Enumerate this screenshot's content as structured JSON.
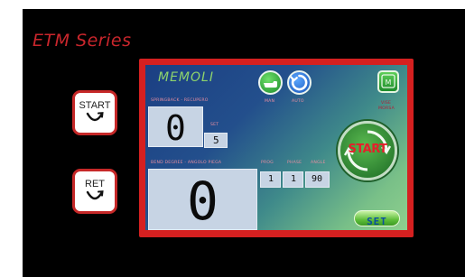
{
  "header": {
    "series_title": "ETM Series"
  },
  "side_buttons": {
    "start_label": "START",
    "ret_label": "RET"
  },
  "screen": {
    "brand": "MEMOLI",
    "springback_label": "SPRINGBACK - RECUPERO",
    "springback_value": "0",
    "set_label": "SET",
    "set_value": "5",
    "bend_label": "BEND DEGREE - ANGOLO PIEGA",
    "bend_value": "0",
    "prog_label": "PROG",
    "phase_label": "PHASE",
    "angle_label": "ANGLE",
    "prog_value": "1",
    "phase_value": "1",
    "angle_value": "90",
    "man_label": "MAN",
    "auto_label": "AUTO",
    "vise_label": "VISE",
    "morsa_label": "MORSA",
    "vise_icon_text": "M",
    "start_button_label": "START",
    "set_button_label": "SET"
  },
  "colors": {
    "frame": "#000000",
    "panel_border": "#d52020",
    "brand_green": "#8ed46c",
    "title_red": "#c9262c",
    "lcd": "#c7d4e4",
    "start_button": "#2f8d3a"
  },
  "icons": {
    "start_side": "undo-arc-icon",
    "ret_side": "undo-arc-icon",
    "manual": "hand-icon",
    "auto": "refresh-cycle-icon",
    "vise": "vise-clamp-icon",
    "start_main": "cycle-arrows-icon"
  }
}
